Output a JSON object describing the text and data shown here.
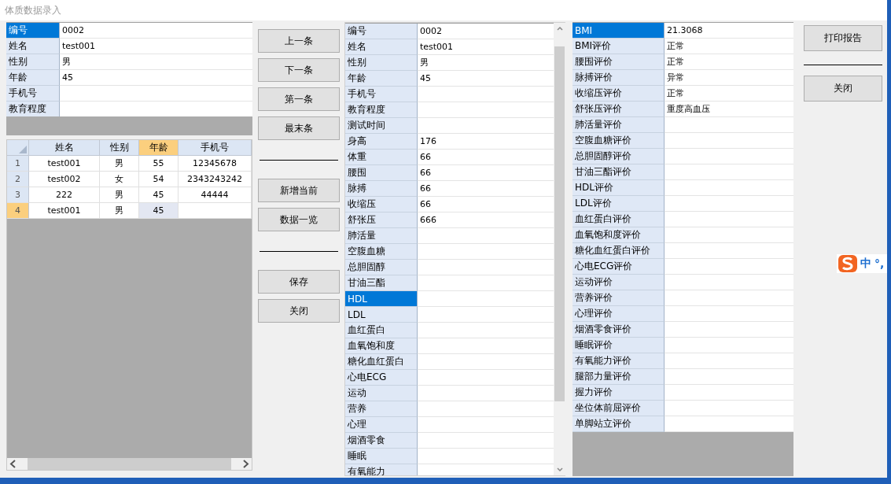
{
  "window": {
    "title": "体质数据录入"
  },
  "basic_info": {
    "rows": [
      {
        "label": "编号",
        "value": "0002",
        "selected": true
      },
      {
        "label": "姓名",
        "value": "test001",
        "selected": false
      },
      {
        "label": "性别",
        "value": "男",
        "selected": false
      },
      {
        "label": "年龄",
        "value": "45",
        "selected": false
      },
      {
        "label": "手机号",
        "value": "",
        "selected": false
      },
      {
        "label": "教育程度",
        "value": "",
        "selected": false
      }
    ]
  },
  "records_table": {
    "columns": [
      {
        "label": "姓名",
        "selected": false
      },
      {
        "label": "性别",
        "selected": false
      },
      {
        "label": "年龄",
        "selected": true
      },
      {
        "label": "手机号",
        "selected": false
      }
    ],
    "rows": [
      {
        "number": "1",
        "selected": false,
        "cells": [
          "test001",
          "男",
          "55",
          "12345678"
        ]
      },
      {
        "number": "2",
        "selected": false,
        "cells": [
          "test002",
          "女",
          "54",
          "2343243242"
        ]
      },
      {
        "number": "3",
        "selected": false,
        "cells": [
          "222",
          "男",
          "45",
          "44444"
        ]
      },
      {
        "number": "4",
        "selected": true,
        "cells": [
          "test001",
          "男",
          "45",
          ""
        ]
      }
    ]
  },
  "nav_buttons": [
    {
      "kind": "button",
      "label": "上一条"
    },
    {
      "kind": "button",
      "label": "下一条"
    },
    {
      "kind": "button",
      "label": "第一条"
    },
    {
      "kind": "button",
      "label": "最末条"
    },
    {
      "kind": "separator"
    },
    {
      "kind": "button",
      "label": "新增当前"
    },
    {
      "kind": "button",
      "label": "数据一览"
    },
    {
      "kind": "separator"
    },
    {
      "kind": "button",
      "label": "保存"
    },
    {
      "kind": "button",
      "label": "关闭"
    }
  ],
  "measurements": {
    "rows": [
      {
        "label": "编号",
        "value": "0002",
        "selected": false
      },
      {
        "label": "姓名",
        "value": "test001",
        "selected": false
      },
      {
        "label": "性别",
        "value": "男",
        "selected": false
      },
      {
        "label": "年龄",
        "value": "45",
        "selected": false
      },
      {
        "label": "手机号",
        "value": "",
        "selected": false
      },
      {
        "label": "教育程度",
        "value": "",
        "selected": false
      },
      {
        "label": "测试时间",
        "value": "",
        "selected": false
      },
      {
        "label": "身高",
        "value": "176",
        "selected": false
      },
      {
        "label": "体重",
        "value": "66",
        "selected": false
      },
      {
        "label": "腰围",
        "value": "66",
        "selected": false
      },
      {
        "label": "脉搏",
        "value": "66",
        "selected": false
      },
      {
        "label": "收缩压",
        "value": "66",
        "selected": false
      },
      {
        "label": "舒张压",
        "value": "666",
        "selected": false
      },
      {
        "label": "肺活量",
        "value": "",
        "selected": false
      },
      {
        "label": "空腹血糖",
        "value": "",
        "selected": false
      },
      {
        "label": "总胆固醇",
        "value": "",
        "selected": false
      },
      {
        "label": "甘油三酯",
        "value": "",
        "selected": false
      },
      {
        "label": "HDL",
        "value": "",
        "selected": true
      },
      {
        "label": "LDL",
        "value": "",
        "selected": false
      },
      {
        "label": "血红蛋白",
        "value": "",
        "selected": false
      },
      {
        "label": "血氧饱和度",
        "value": "",
        "selected": false
      },
      {
        "label": "糖化血红蛋白",
        "value": "",
        "selected": false
      },
      {
        "label": "心电ECG",
        "value": "",
        "selected": false
      },
      {
        "label": "运动",
        "value": "",
        "selected": false
      },
      {
        "label": "营养",
        "value": "",
        "selected": false
      },
      {
        "label": "心理",
        "value": "",
        "selected": false
      },
      {
        "label": "烟酒零食",
        "value": "",
        "selected": false
      },
      {
        "label": "睡眠",
        "value": "",
        "selected": false
      },
      {
        "label": "有氧能力",
        "value": "",
        "selected": false
      }
    ]
  },
  "evaluations": {
    "rows": [
      {
        "label": "BMI",
        "value": "21.3068",
        "selected": true
      },
      {
        "label": "BMI评价",
        "value": "正常",
        "selected": false
      },
      {
        "label": "腰围评价",
        "value": "正常",
        "selected": false
      },
      {
        "label": "脉搏评价",
        "value": "异常",
        "selected": false
      },
      {
        "label": "收缩压评价",
        "value": "正常",
        "selected": false
      },
      {
        "label": "舒张压评价",
        "value": "重度高血压",
        "selected": false
      },
      {
        "label": "肺活量评价",
        "value": "",
        "selected": false
      },
      {
        "label": "空腹血糖评价",
        "value": "",
        "selected": false
      },
      {
        "label": "总胆固醇评价",
        "value": "",
        "selected": false
      },
      {
        "label": "甘油三酯评价",
        "value": "",
        "selected": false
      },
      {
        "label": "HDL评价",
        "value": "",
        "selected": false
      },
      {
        "label": "LDL评价",
        "value": "",
        "selected": false
      },
      {
        "label": "血红蛋白评价",
        "value": "",
        "selected": false
      },
      {
        "label": "血氧饱和度评价",
        "value": "",
        "selected": false
      },
      {
        "label": "糖化血红蛋白评价",
        "value": "",
        "selected": false
      },
      {
        "label": "心电ECG评价",
        "value": "",
        "selected": false
      },
      {
        "label": "运动评价",
        "value": "",
        "selected": false
      },
      {
        "label": "营养评价",
        "value": "",
        "selected": false
      },
      {
        "label": "心理评价",
        "value": "",
        "selected": false
      },
      {
        "label": "烟酒零食评价",
        "value": "",
        "selected": false
      },
      {
        "label": "睡眠评价",
        "value": "",
        "selected": false
      },
      {
        "label": "有氧能力评价",
        "value": "",
        "selected": false
      },
      {
        "label": "腿部力量评价",
        "value": "",
        "selected": false
      },
      {
        "label": "握力评价",
        "value": "",
        "selected": false
      },
      {
        "label": "坐位体前屈评价",
        "value": "",
        "selected": false
      },
      {
        "label": "单脚站立评价",
        "value": "",
        "selected": false
      }
    ]
  },
  "report_buttons": [
    {
      "kind": "button",
      "label": "打印报告"
    },
    {
      "kind": "separator"
    },
    {
      "kind": "button",
      "label": "关闭"
    }
  ],
  "ime": {
    "mode": "中",
    "punct": "°,"
  }
}
